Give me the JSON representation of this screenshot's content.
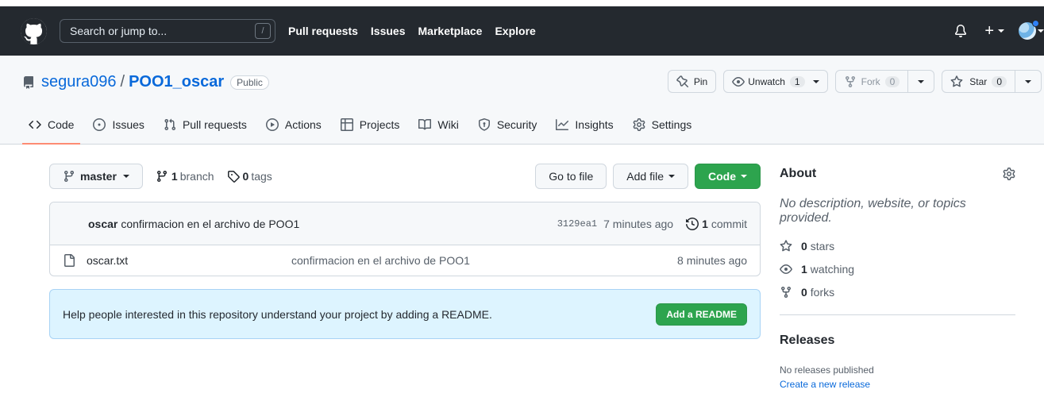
{
  "header": {
    "search_placeholder": "Search or jump to...",
    "search_shortcut": "/",
    "nav": [
      "Pull requests",
      "Issues",
      "Marketplace",
      "Explore"
    ]
  },
  "repo": {
    "owner": "segura096",
    "separator": "/",
    "name": "POO1_oscar",
    "visibility": "Public",
    "pin_label": "Pin",
    "unwatch_label": "Unwatch",
    "unwatch_count": "1",
    "fork_label": "Fork",
    "fork_count": "0",
    "star_label": "Star",
    "star_count": "0"
  },
  "tabs": [
    {
      "label": "Code",
      "icon": "code-icon"
    },
    {
      "label": "Issues",
      "icon": "issue-icon"
    },
    {
      "label": "Pull requests",
      "icon": "pull-request-icon"
    },
    {
      "label": "Actions",
      "icon": "play-icon"
    },
    {
      "label": "Projects",
      "icon": "table-icon"
    },
    {
      "label": "Wiki",
      "icon": "book-icon"
    },
    {
      "label": "Security",
      "icon": "shield-icon"
    },
    {
      "label": "Insights",
      "icon": "graph-icon"
    },
    {
      "label": "Settings",
      "icon": "gear-icon"
    }
  ],
  "branchbar": {
    "branch": "master",
    "branch_count": "1",
    "branch_word": "branch",
    "tag_count": "0",
    "tag_word": "tags",
    "go_to_file": "Go to file",
    "add_file": "Add file",
    "code": "Code"
  },
  "commit": {
    "author": "oscar",
    "message": "confirmacion en el archivo de POO1",
    "sha": "3129ea1",
    "ago": "7 minutes ago",
    "count": "1",
    "count_word": "commit"
  },
  "files": [
    {
      "name": "oscar.txt",
      "message": "confirmacion en el archivo de POO1",
      "ago": "8 minutes ago"
    }
  ],
  "readme": {
    "text": "Help people interested in this repository understand your project by adding a README.",
    "button": "Add a README"
  },
  "about": {
    "title": "About",
    "description": "No description, website, or topics provided.",
    "stars_count": "0",
    "stars_word": "stars",
    "watching_count": "1",
    "watching_word": "watching",
    "forks_count": "0",
    "forks_word": "forks"
  },
  "releases": {
    "title": "Releases",
    "none": "No releases published",
    "create_link": "Create a new release"
  },
  "colors": {
    "header_bg": "#24292f",
    "link": "#0969da",
    "green": "#2da44e",
    "active_tab": "#fd8c73",
    "readme_bg": "#ddf4ff"
  }
}
